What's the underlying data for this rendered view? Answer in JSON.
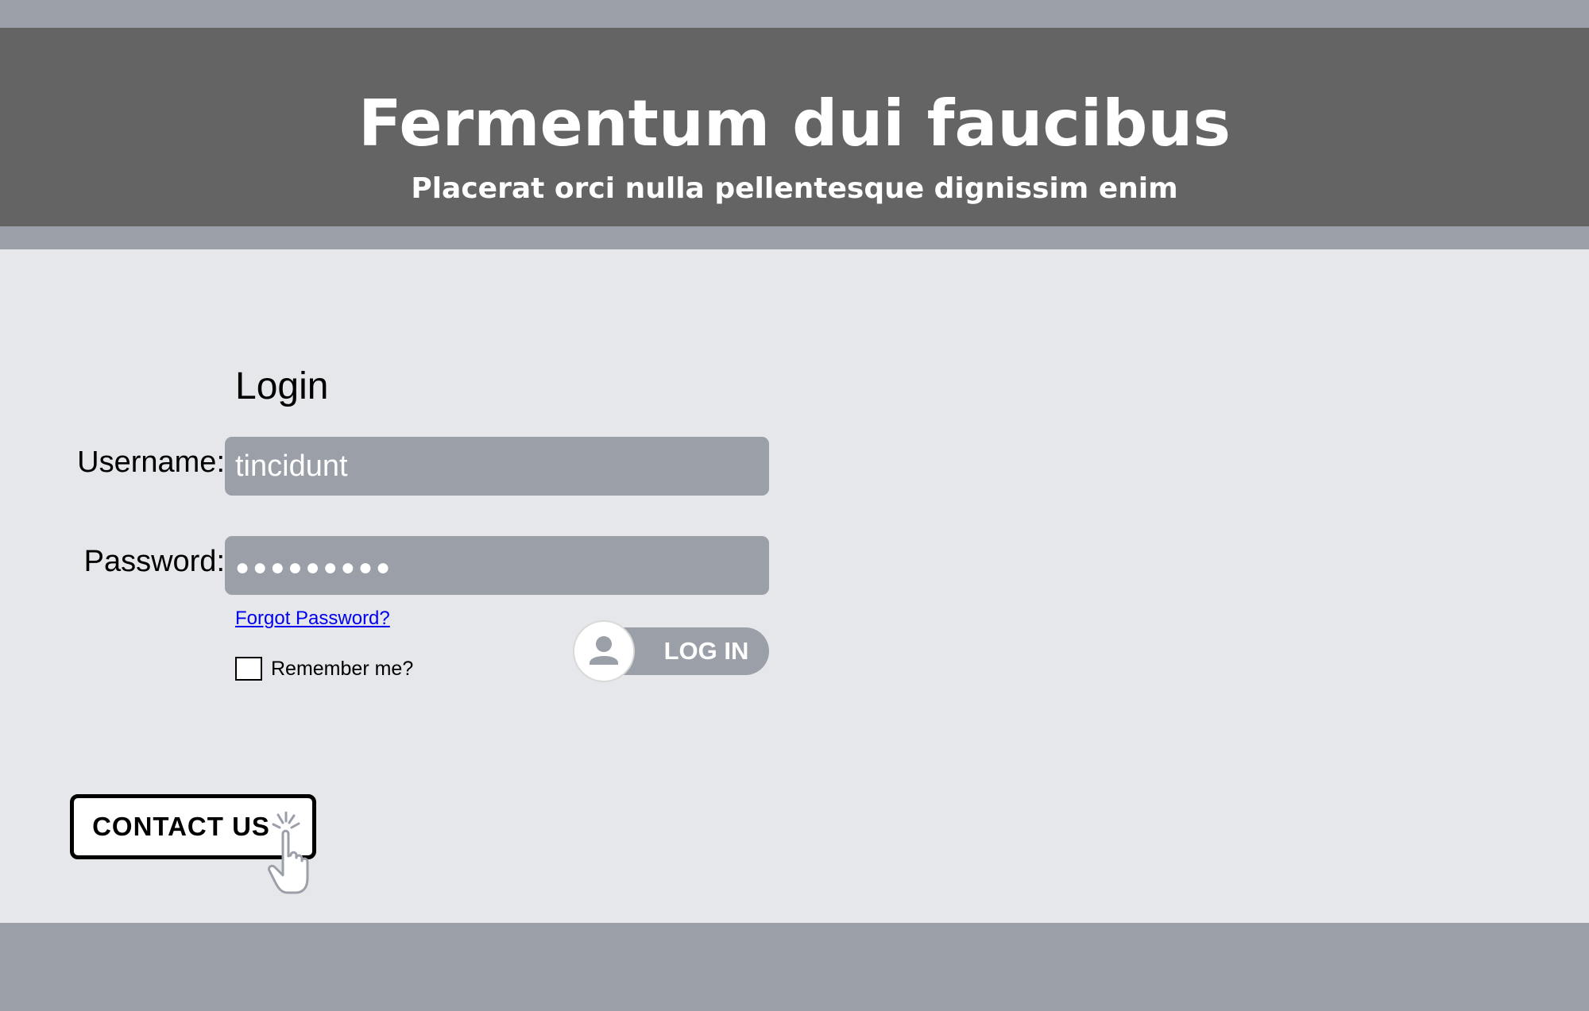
{
  "header": {
    "title": "Fermentum dui faucibus",
    "subtitle": "Placerat orci nulla pellentesque dignissim enim"
  },
  "login": {
    "title": "Login",
    "username_label": "Username:",
    "username_value": "tincidunt",
    "password_label": "Password:",
    "password_value": "●●●●●●●●●",
    "forgot_link": "Forgot Password?",
    "remember_label": "Remember me?",
    "remember_checked": false,
    "login_button_label": "LOG IN",
    "login_button_icon": "user-icon"
  },
  "contact": {
    "button_label": "CONTACT US",
    "cursor_icon": "hand-pointer-icon"
  },
  "colors": {
    "header_bg": "#646464",
    "band_bg": "#9a9fa8",
    "main_bg": "#e6e7ea",
    "link": "#0000ee"
  }
}
